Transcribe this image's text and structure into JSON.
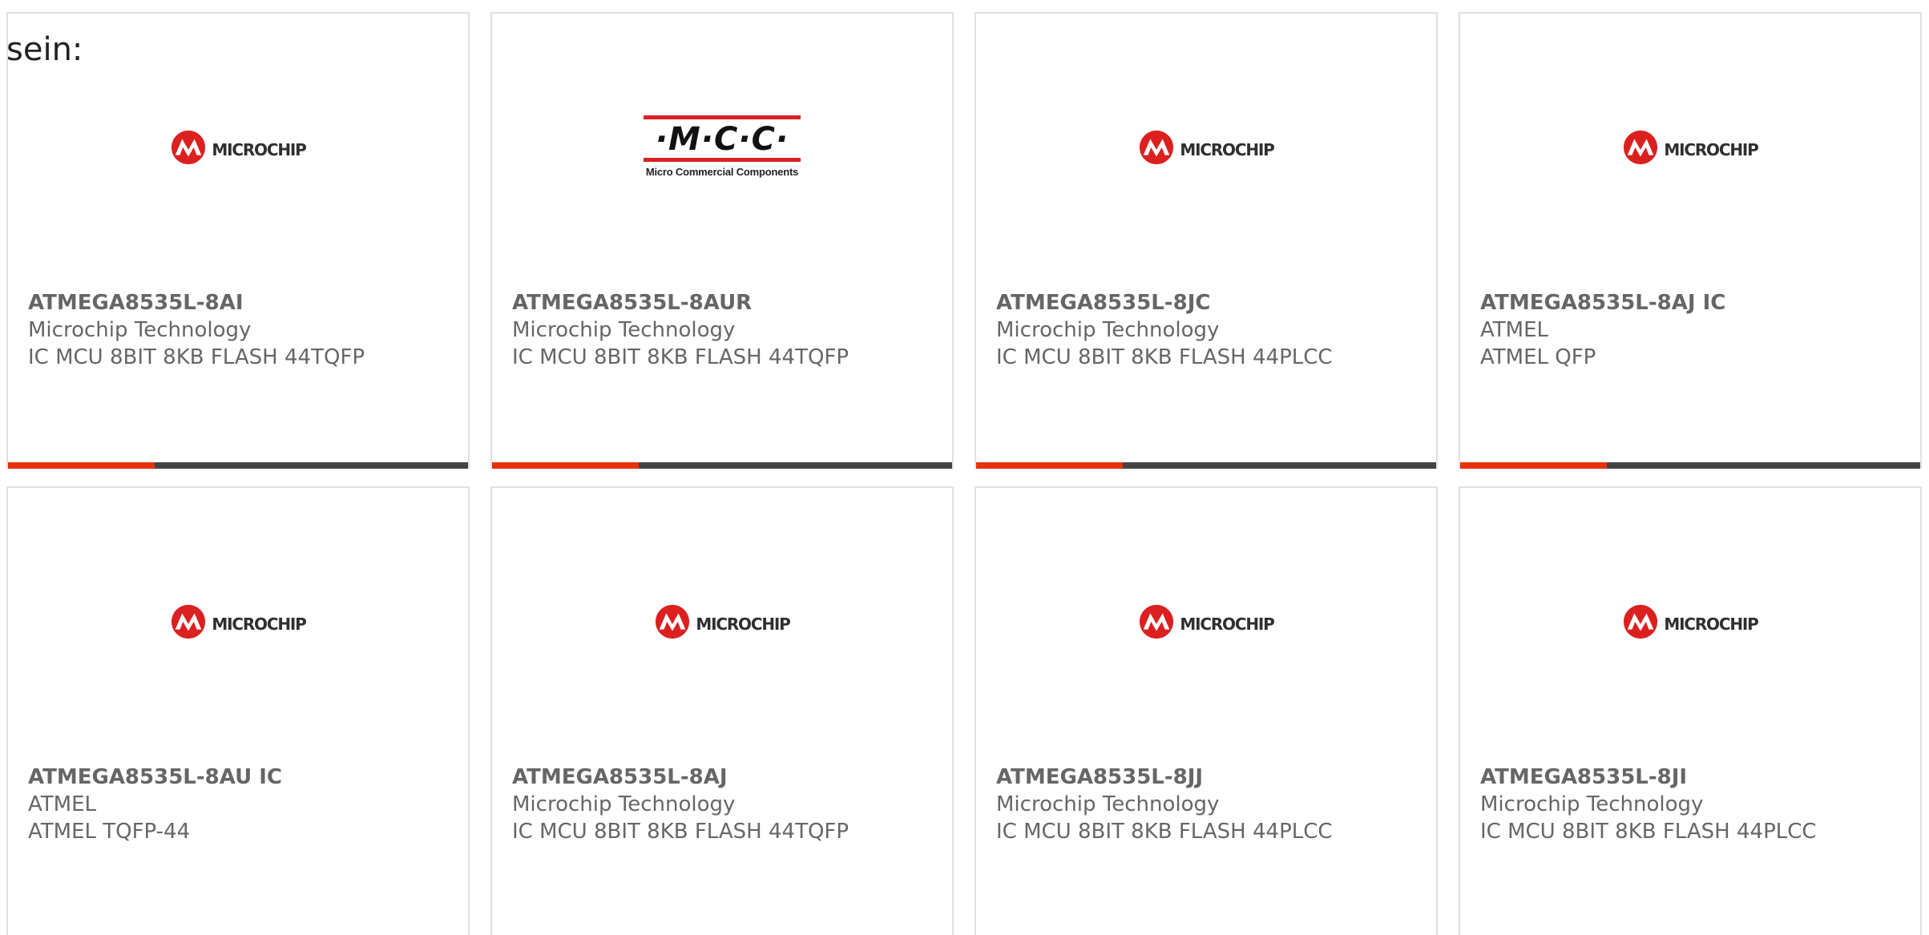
{
  "intro": "sein:",
  "colors": {
    "accent": "#e63208",
    "bar": "#444444",
    "card_border": "#e1e1e1",
    "text": "#666666",
    "microchip_red": "#dc2020"
  },
  "logos": {
    "microchip": {
      "icon": "microchip-logo-icon",
      "word": "Microchip"
    },
    "mcc": {
      "main": "·M·C·C·",
      "sub": "Micro Commercial Components"
    }
  },
  "products": [
    {
      "part": "ATMEGA8535L-8AI",
      "manufacturer": "Microchip Technology",
      "description": "IC MCU 8BIT 8KB FLASH 44TQFP",
      "logo": "microchip"
    },
    {
      "part": "ATMEGA8535L-8AUR",
      "manufacturer": "Microchip Technology",
      "description": "IC MCU 8BIT 8KB FLASH 44TQFP",
      "logo": "mcc"
    },
    {
      "part": "ATMEGA8535L-8JC",
      "manufacturer": "Microchip Technology",
      "description": "IC MCU 8BIT 8KB FLASH 44PLCC",
      "logo": "microchip"
    },
    {
      "part": "ATMEGA8535L-8AJ IC",
      "manufacturer": "ATMEL",
      "description": "ATMEL QFP",
      "logo": "microchip"
    },
    {
      "part": "ATMEGA8535L-8AU IC",
      "manufacturer": "ATMEL",
      "description": "ATMEL TQFP-44",
      "logo": "microchip"
    },
    {
      "part": "ATMEGA8535L-8AJ",
      "manufacturer": "Microchip Technology",
      "description": "IC MCU 8BIT 8KB FLASH 44TQFP",
      "logo": "microchip"
    },
    {
      "part": "ATMEGA8535L-8JJ",
      "manufacturer": "Microchip Technology",
      "description": "IC MCU 8BIT 8KB FLASH 44PLCC",
      "logo": "microchip"
    },
    {
      "part": "ATMEGA8535L-8JI",
      "manufacturer": "Microchip Technology",
      "description": "IC MCU 8BIT 8KB FLASH 44PLCC",
      "logo": "microchip"
    }
  ]
}
